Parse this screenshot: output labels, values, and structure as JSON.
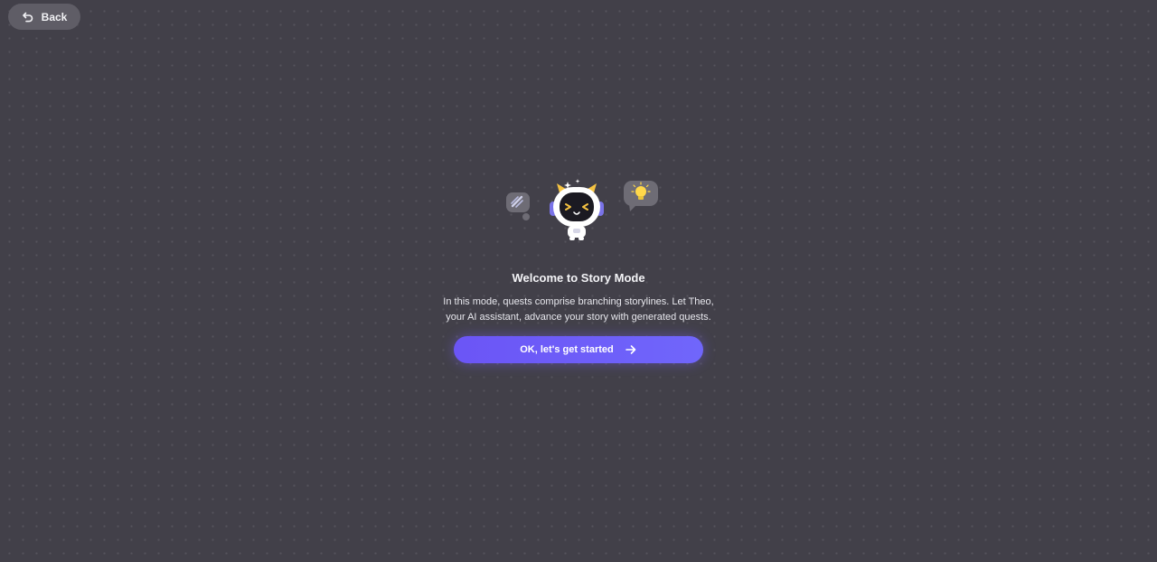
{
  "header": {
    "back_label": "Back",
    "back_icon": "undo-arrow-icon"
  },
  "welcome": {
    "title": "Welcome to Story Mode",
    "description": "In this mode, quests comprise branching storylines. Let Theo, your AI assistant, advance your story with generated quests.",
    "mascot": "theo-mascot",
    "start_label": "OK, let's get started",
    "start_icon": "arrow-right-icon"
  },
  "colors": {
    "background": "#424049",
    "button_accent": "#6b55f6",
    "back_button": "#5f5d66"
  }
}
